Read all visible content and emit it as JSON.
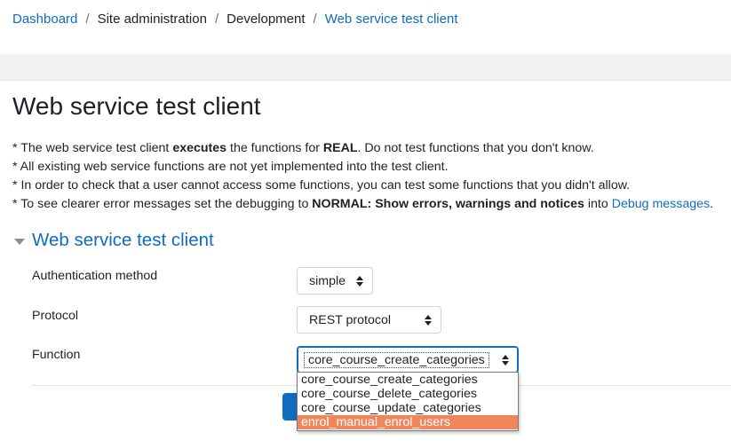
{
  "breadcrumb": {
    "items": [
      "Dashboard",
      "Site administration",
      "Development",
      "Web service test client"
    ],
    "separator": "/"
  },
  "page": {
    "title": "Web service test client"
  },
  "notes": {
    "line1": {
      "a": "* The web service test client ",
      "b": "executes",
      "c": " the functions for ",
      "d": "REAL",
      "e": ". Do not test functions that you don't know."
    },
    "line2": "* All existing web service functions are not yet implemented into the test client.",
    "line3": "* In order to check that a user cannot access some functions, you can test some functions that you didn't allow.",
    "line4": {
      "a": "* To see clearer error messages set the debugging to ",
      "b": "NORMAL: Show errors, warnings and notices",
      "c": " into ",
      "link": "Debug messages",
      "d": "."
    }
  },
  "form": {
    "legend": "Web service test client",
    "auth": {
      "label": "Authentication method",
      "value": "simple"
    },
    "protocol": {
      "label": "Protocol",
      "value": "REST protocol"
    },
    "function": {
      "label": "Function",
      "value": "core_course_create_categories",
      "options": [
        "core_course_create_categories",
        "core_course_delete_categories",
        "core_course_update_categories",
        "enrol_manual_enrol_users"
      ],
      "highlighted": "enrol_manual_enrol_users"
    }
  },
  "colors": {
    "link": "#0f6cbf",
    "highlight": "#f0875c",
    "band": "#f2f2f2"
  }
}
